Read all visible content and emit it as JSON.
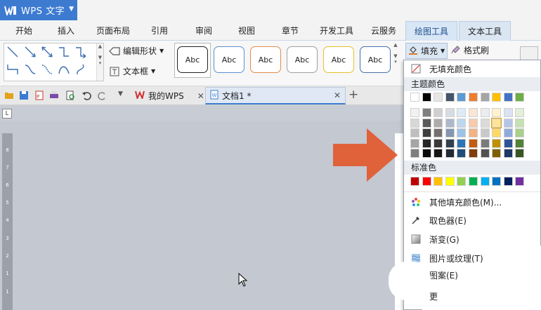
{
  "app": {
    "title": "WPS 文字",
    "brand_color": "#3d7bd1"
  },
  "menu_tabs": [
    "开始",
    "插入",
    "页面布局",
    "引用",
    "审阅",
    "视图",
    "章节",
    "开发工具",
    "云服务",
    "绘图工具",
    "文本工具"
  ],
  "menu_active": "绘图工具",
  "ribbon": {
    "edit_shape_label": "编辑形状",
    "textbox_label": "文本框",
    "style_label": "Abc",
    "style_colors": [
      "#222222",
      "#5b8fd0",
      "#e08c4a",
      "#a0a0a0",
      "#e8c12a",
      "#4a6fa8"
    ],
    "fill_label": "填充",
    "format_brush_label": "格式刷"
  },
  "toolbar": {
    "tabs": [
      {
        "label": "我的WPS",
        "icon": "wps-logo-icon"
      },
      {
        "label": "文档1 *",
        "icon": "document-icon"
      }
    ],
    "new_tab": "+"
  },
  "fill_menu": {
    "no_fill_label": "无填充颜色",
    "theme_section": "主题颜色",
    "theme_top_row": [
      "#ffffff",
      "#000000",
      "#e7e6e6",
      "#44546a",
      "#5b9bd5",
      "#ed7d31",
      "#a5a5a5",
      "#ffc000",
      "#4472c4",
      "#70ad47"
    ],
    "theme_shades": [
      [
        "#f2f2f2",
        "#7f7f7f",
        "#d0cece",
        "#d6dce4",
        "#deebf6",
        "#fbe5d5",
        "#ededed",
        "#fff2cc",
        "#dae3f3",
        "#e2efd9"
      ],
      [
        "#d8d8d8",
        "#595959",
        "#aeabab",
        "#adb9ca",
        "#bdd7ee",
        "#f7cbac",
        "#dbdbdb",
        "#fee599",
        "#b4c6e7",
        "#c5e0b3"
      ],
      [
        "#bfbfbf",
        "#3f3f3f",
        "#757070",
        "#8496b0",
        "#9cc3e5",
        "#f4b183",
        "#c9c9c9",
        "#ffd965",
        "#8eaadb",
        "#a8d08d"
      ],
      [
        "#a5a5a5",
        "#262626",
        "#3a3838",
        "#323f4f",
        "#2e75b5",
        "#c55a11",
        "#7b7b7b",
        "#bf9000",
        "#2f5496",
        "#538135"
      ],
      [
        "#7f7f7f",
        "#0c0c0c",
        "#171616",
        "#222a35",
        "#1e4e79",
        "#833c0b",
        "#525252",
        "#7f6000",
        "#1f3864",
        "#375623"
      ]
    ],
    "standard_section": "标准色",
    "standard_colors": [
      "#c00000",
      "#ff0000",
      "#ffc000",
      "#ffff00",
      "#92d050",
      "#00b050",
      "#00b0f0",
      "#0070c0",
      "#002060",
      "#7030a0"
    ],
    "more_colors_label": "其他填充颜色(M)...",
    "eyedropper_label": "取色器(E)",
    "gradient_label": "渐变(G)",
    "picture_texture_label": "图片或纹理(T)",
    "pattern_label": "图案(E)",
    "more_label": "更"
  },
  "ruler_numbers": [
    "8",
    "7",
    "6",
    "5",
    "4",
    "3",
    "2",
    "1",
    "1"
  ],
  "annotation_arrow_color": "#e0623b"
}
